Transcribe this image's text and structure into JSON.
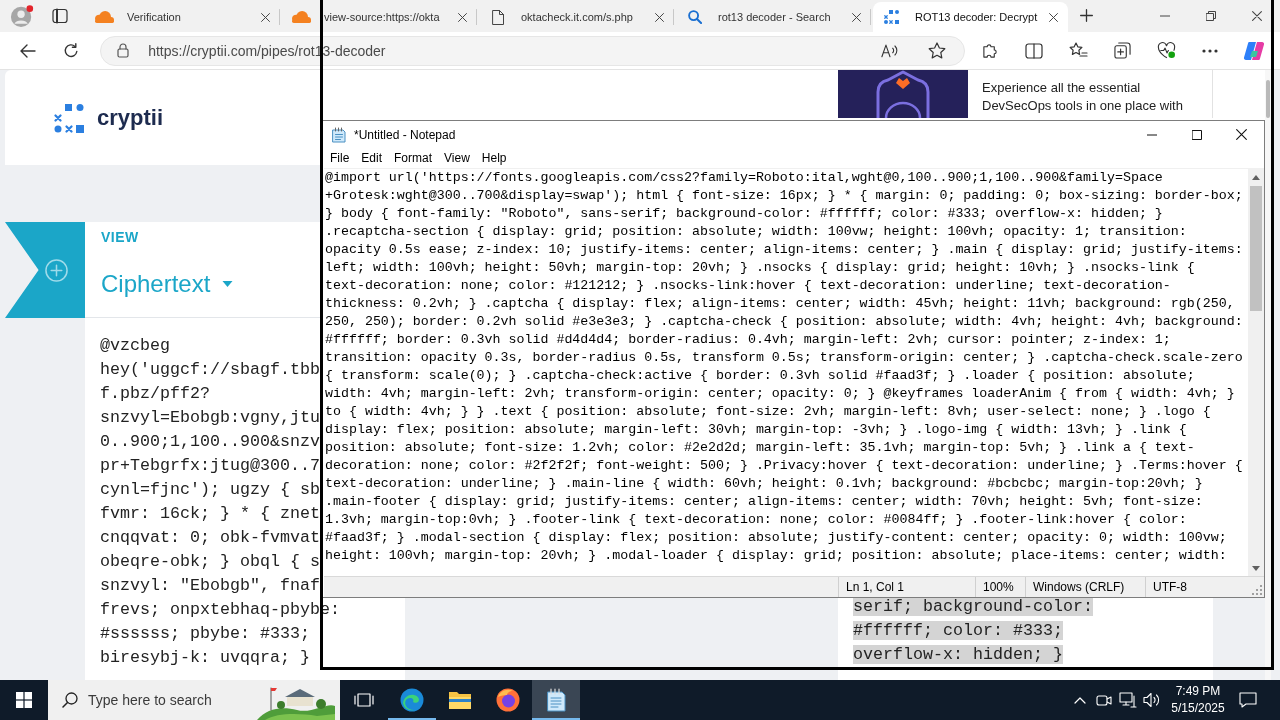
{
  "browser": {
    "tabs": [
      {
        "kind": "cloud",
        "title": "Verification",
        "selected": false
      },
      {
        "kind": "cloud",
        "title": "view-source:https://okta",
        "selected": false
      },
      {
        "kind": "page",
        "title": "oktacheck.it.com/s.php",
        "selected": false
      },
      {
        "kind": "search",
        "title": "rot13 decoder - Search",
        "selected": false
      },
      {
        "kind": "dots",
        "title": "ROT13 decoder: Decrypt",
        "selected": true
      }
    ],
    "url": "https://cryptii.com/pipes/rot13-decoder"
  },
  "page": {
    "logo_text": "cryptii",
    "ad": {
      "text_lines": [
        "Experience all the essential",
        "DevSecOps tools in one place with"
      ]
    },
    "viewer": {
      "label": "VIEW",
      "format": "Ciphertext",
      "lines": [
        "@vzcbeg",
        "hey('uggcf://sbagf.tbb",
        "f.pbz/pff2?",
        "snzvyl=Ebobgb:vgny,jtu",
        "0..900;1,100..900&snzv",
        "pr+Tebgrfx:jtug@300..7",
        "cynl=fjnc'); ugzy { sb",
        "fvmr: 16ck; } * { znet",
        "cnqqvat: 0; obk-fvmvat",
        "obeqre-obk; } obql { s",
        "snzvyl: \"Ebobgb\", fnaf",
        "frevs; onpxtebhaq-pbybe:",
        "#ssssss; pbybe: #333;",
        "biresybj-k: uvqqra; }"
      ]
    },
    "output": {
      "lines": [
        "serif; background-color:",
        "#ffffff; color: #333;",
        "overflow-x: hidden; }"
      ],
      "highlighted": true
    }
  },
  "notepad": {
    "title": "*Untitled - Notepad",
    "menu": [
      "File",
      "Edit",
      "Format",
      "View",
      "Help"
    ],
    "text_lines": [
      "@import url('https://fonts.googleapis.com/css2?family=Roboto:ital,wght@0,100..900;1,100..900&family=Space",
      "+Grotesk:wght@300..700&display=swap'); html { font-size: 16px; } * { margin: 0; padding: 0; box-sizing: border-box;",
      "} body { font-family: \"Roboto\", sans-serif; background-color: #ffffff; color: #333; overflow-x: hidden; }",
      ".recaptcha-section { display: grid; position: absolute; width: 100vw; height: 100vh; opacity: 1; transition:",
      "opacity 0.5s ease; z-index: 10; justify-items: center; align-items: center; } .main { display: grid; justify-items:",
      "left; width: 100vh; height: 50vh; margin-top: 20vh; } .nsocks { display: grid; height: 10vh; } .nsocks-link {",
      "text-decoration: none; color: #121212; } .nsocks-link:hover { text-decoration: underline; text-decoration-",
      "thickness: 0.2vh; } .captcha { display: flex; align-items: center; width: 45vh; height: 11vh; background: rgb(250,",
      "250, 250); border: 0.2vh solid #e3e3e3; } .captcha-check { position: absolute; width: 4vh; height: 4vh; background:",
      "#ffffff; border: 0.3vh solid #d4d4d4; border-radius: 0.4vh; margin-left: 2vh; cursor: pointer; z-index: 1;",
      "transition: opacity 0.3s, border-radius 0.5s, transform 0.5s; transform-origin: center; } .captcha-check.scale-zero",
      "{ transform: scale(0); } .captcha-check:active { border: 0.3vh solid #faad3f; } .loader { position: absolute;",
      "width: 4vh; margin-left: 2vh; transform-origin: center; opacity: 0; } @keyframes loaderAnim { from { width: 4vh; }",
      "to { width: 4vh; } } .text { position: absolute; font-size: 2vh; margin-left: 8vh; user-select: none; } .logo {",
      "display: flex; position: absolute; margin-left: 30vh; margin-top: -3vh; } .logo-img { width: 13vh; } .link {",
      "position: absolute; font-size: 1.2vh; color: #2e2d2d; margin-left: 35.1vh; margin-top: 5vh; } .link a { text-",
      "decoration: none; color: #2f2f2f; font-weight: 500; } .Privacy:hover { text-decoration: underline; } .Terms:hover {",
      "text-decoration: underline; } .main-line { width: 60vh; height: 0.1vh; background: #bcbcbc; margin-top:20vh; }",
      ".main-footer { display: grid; justify-items: center; align-items: center; width: 70vh; height: 5vh; font-size:",
      "1.3vh; margin-top:0vh; } .footer-link { text-decoration: none; color: #0084ff; } .footer-link:hover { color:",
      "#faad3f; } .modal-section { display: flex; position: absolute; justify-content: center; opacity: 0; width: 100vw;",
      "height: 100vh; margin-top: 20vh; } .modal-loader { display: grid; position: absolute; place-items: center; width:"
    ],
    "status": [
      "Ln 1, Col 1",
      "100%",
      "Windows (CRLF)",
      "UTF-8"
    ]
  },
  "taskbar": {
    "search": {
      "placeholder": "Type here to search"
    },
    "apps": [
      {
        "kind": "task-view",
        "running": false,
        "active": false
      },
      {
        "kind": "wave-browser",
        "running": true,
        "active": false
      },
      {
        "kind": "folder",
        "running": false,
        "active": false
      },
      {
        "kind": "fox-browser",
        "running": false,
        "active": false
      },
      {
        "kind": "notepad",
        "running": true,
        "active": true
      }
    ],
    "time": "7:49 PM",
    "date": "5/15/2025"
  }
}
